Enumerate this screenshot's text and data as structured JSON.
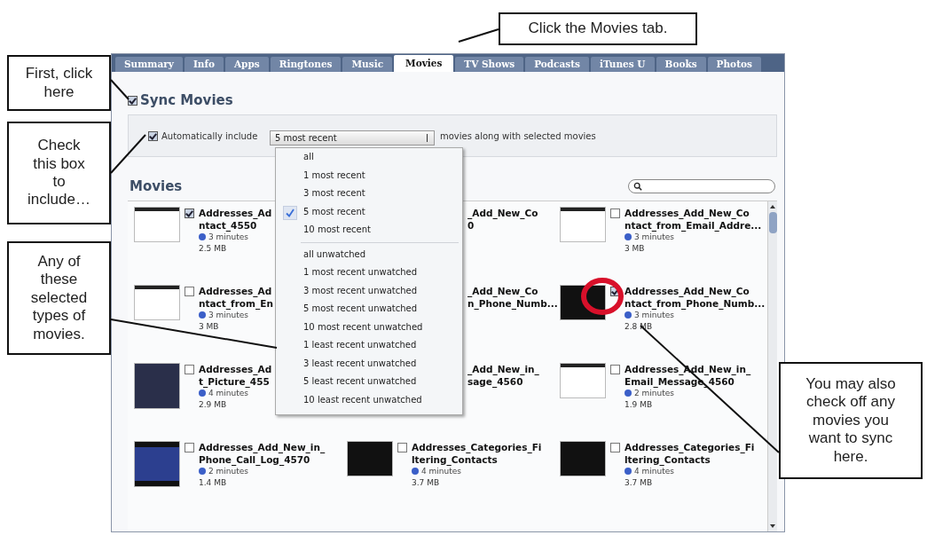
{
  "callouts": [
    {
      "text": "Click the Movies tab."
    },
    {
      "text": "First, click here"
    },
    {
      "text": "Check this box to include…"
    },
    {
      "text": "Any of these selected types of movies."
    },
    {
      "text": "You may also check off any movies you want to sync here."
    }
  ],
  "tabs": [
    {
      "label": "Summary",
      "selected": false
    },
    {
      "label": "Info",
      "selected": false
    },
    {
      "label": "Apps",
      "selected": false
    },
    {
      "label": "Ringtones",
      "selected": false
    },
    {
      "label": "Music",
      "selected": false
    },
    {
      "label": "Movies",
      "selected": true
    },
    {
      "label": "TV Shows",
      "selected": false
    },
    {
      "label": "Podcasts",
      "selected": false
    },
    {
      "label": "iTunes U",
      "selected": false
    },
    {
      "label": "Books",
      "selected": false
    },
    {
      "label": "Photos",
      "selected": false
    }
  ],
  "sync_movies": {
    "label": "Sync Movies",
    "checked": true
  },
  "auto_include": {
    "label": "Automatically include",
    "checked": true,
    "value": "5 most recent",
    "suffix": "movies along with selected movies"
  },
  "dropdown": {
    "groups": [
      [
        {
          "label": "all",
          "selected": false
        },
        {
          "label": "1 most recent",
          "selected": false
        },
        {
          "label": "3 most recent",
          "selected": false
        },
        {
          "label": "5 most recent",
          "selected": true
        },
        {
          "label": "10 most recent",
          "selected": false
        }
      ],
      [
        {
          "label": "all unwatched",
          "selected": false
        },
        {
          "label": "1 most recent unwatched",
          "selected": false
        },
        {
          "label": "3 most recent unwatched",
          "selected": false
        },
        {
          "label": "5 most recent unwatched",
          "selected": false
        },
        {
          "label": "10 most recent unwatched",
          "selected": false
        },
        {
          "label": "1 least recent unwatched",
          "selected": false
        },
        {
          "label": "3 least recent unwatched",
          "selected": false
        },
        {
          "label": "5 least recent unwatched",
          "selected": false
        },
        {
          "label": "10 least recent unwatched",
          "selected": false
        }
      ]
    ]
  },
  "movies": {
    "heading": "Movies",
    "rows": [
      [
        {
          "kind": "full",
          "title": [
            "Addresses_Ad",
            "ntact_4550"
          ],
          "checked": true,
          "duration": "3 minutes",
          "size": "2.5 MB"
        },
        {
          "kind": "fragment",
          "title": [
            "_Add_New_Co",
            "0"
          ]
        },
        {
          "kind": "full",
          "title": [
            "Addresses_Add_New_Co",
            "ntact_from_Email_Addre..."
          ],
          "checked": false,
          "duration": "3 minutes",
          "size": "3 MB"
        }
      ],
      [
        {
          "kind": "full",
          "title": [
            "Addresses_Ad",
            "ntact_from_En"
          ],
          "checked": false,
          "duration": "3 minutes",
          "size": "3 MB"
        },
        {
          "kind": "fragment",
          "title": [
            "_Add_New_Co",
            "n_Phone_Numb..."
          ]
        },
        {
          "kind": "full",
          "title": [
            "Addresses_Add_New_Co",
            "ntact_from_Phone_Numb..."
          ],
          "checked": true,
          "duration": "3 minutes",
          "size": "2.8 MB"
        }
      ],
      [
        {
          "kind": "full",
          "title": [
            "Addresses_Ad",
            "t_Picture_455"
          ],
          "checked": false,
          "duration": "4 minutes",
          "size": "2.9 MB"
        },
        {
          "kind": "fragment",
          "title": [
            "_Add_New_in_",
            "sage_4560"
          ]
        },
        {
          "kind": "full",
          "title": [
            "Addresses_Add_New_in_",
            "Email_Message_4560"
          ],
          "checked": false,
          "duration": "2 minutes",
          "size": "1.9 MB"
        }
      ],
      [
        {
          "kind": "full",
          "title": [
            "Addresses_Add_New_in_",
            "Phone_Call_Log_4570"
          ],
          "checked": false,
          "duration": "2 minutes",
          "size": "1.4 MB"
        },
        {
          "kind": "full",
          "title": [
            "Addresses_Categories_Fi",
            "ltering_Contacts"
          ],
          "checked": false,
          "duration": "4 minutes",
          "size": "3.7 MB"
        },
        {
          "kind": "full",
          "title": [
            "Addresses_Categories_Fi",
            "ltering_Contacts"
          ],
          "checked": false,
          "duration": "4 minutes",
          "size": "3.7 MB"
        }
      ]
    ]
  }
}
